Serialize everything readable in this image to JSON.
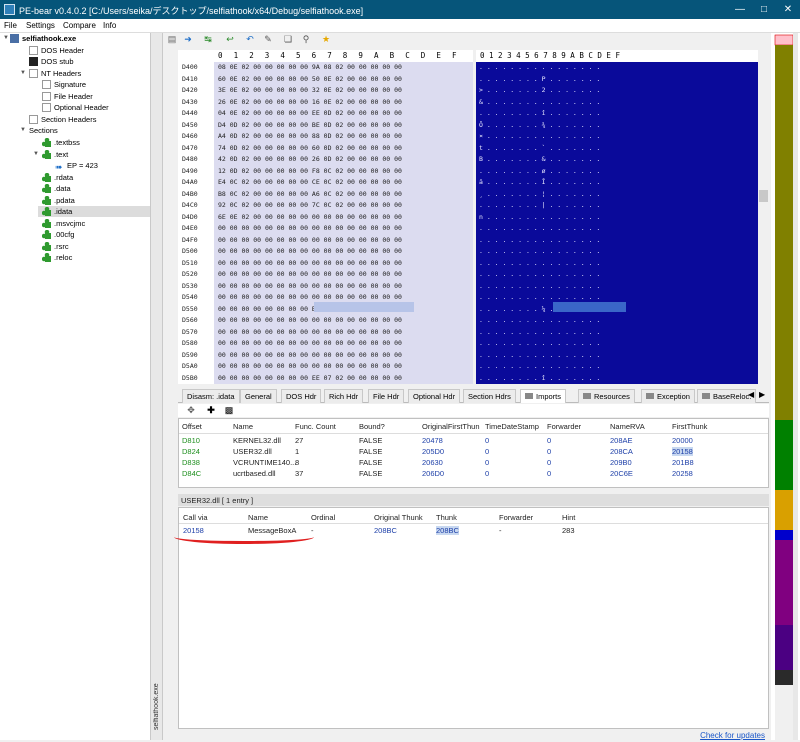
{
  "window": {
    "title": "PE-bear v0.4.0.2 [C:/Users/seika/デスクトップ/selfiathook/x64/Debug/selfiathook.exe]"
  },
  "menu": [
    "File",
    "Settings",
    "Compare",
    "Info"
  ],
  "tree": {
    "root": "selfiathook.exe",
    "dos_header": "DOS Header",
    "dos_stub": "DOS stub",
    "nt_headers": "NT Headers",
    "signature": "Signature",
    "file_header": "File Header",
    "optional_header": "Optional Header",
    "section_headers": "Section Headers",
    "sections": "Sections",
    "sec_textbss": ".textbss",
    "sec_text": ".text",
    "ep": "EP = 423",
    "sec_rdata": ".rdata",
    "sec_data": ".data",
    "sec_pdata": ".pdata",
    "sec_idata": ".idata",
    "sec_msvcjmc": ".msvcjmc",
    "sec_00cfg": ".00cfg",
    "sec_rsrc": ".rsrc",
    "sec_reloc": ".reloc"
  },
  "side_tab": "selfiathook.exe",
  "hex": {
    "header_hex": [
      "0",
      "1",
      "2",
      "3",
      "4",
      "5",
      "6",
      "7",
      "8",
      "9",
      "A",
      "B",
      "C",
      "D",
      "E",
      "F"
    ],
    "header_ascii": "0 1 2 3 4 5 6 7 8 9 A B C D E F",
    "rows": [
      {
        "addr": "D400",
        "hex": "08 0E 02 00 00 00 00 00 9A 08 02 00 00 00 00 00",
        "ascii": ". . . . . . . . . . . . . . . ."
      },
      {
        "addr": "D410",
        "hex": "60 0E 02 00 00 00 00 00 50 0E 02 00 00 00 00 00",
        "ascii": ". . . . . . . . P . . . . . . ."
      },
      {
        "addr": "D420",
        "hex": "3E 0E 02 00 00 00 00 00 32 0E 02 00 00 00 00 00",
        "ascii": "> . . . . . . . 2 . . . . . . ."
      },
      {
        "addr": "D430",
        "hex": "26 0E 02 00 00 00 00 00 16 0E 02 00 00 00 00 00",
        "ascii": "& . . . . . . . . . . . . . . ."
      },
      {
        "addr": "D440",
        "hex": "04 0E 02 00 00 00 00 00 EE 0D 02 00 00 00 00 00",
        "ascii": ". . . . . . . . î . . . . . . ."
      },
      {
        "addr": "D450",
        "hex": "D4 0D 02 00 00 00 00 00 BE 0D 02 00 00 00 00 00",
        "ascii": "Ô . . . . . . . ¾ . . . . . . ."
      },
      {
        "addr": "D460",
        "hex": "A4 0D 02 00 00 00 00 00 88 0D 02 00 00 00 00 00",
        "ascii": "¤ . . . . . . . . . . . . . . ."
      },
      {
        "addr": "D470",
        "hex": "74 0D 02 00 00 00 00 00 60 0D 02 00 00 00 00 00",
        "ascii": "t . . . . . . . ` . . . . . . ."
      },
      {
        "addr": "D480",
        "hex": "42 0D 02 00 00 00 00 00 26 0D 02 00 00 00 00 00",
        "ascii": "B . . . . . . . & . . . . . . ."
      },
      {
        "addr": "D490",
        "hex": "12 0D 02 00 00 00 00 00 F8 0C 02 00 00 00 00 00",
        "ascii": ". . . . . . . . ø . . . . . . ."
      },
      {
        "addr": "D4A0",
        "hex": "E4 0C 02 00 00 00 00 00 CE 0C 02 00 00 00 00 00",
        "ascii": "ä . . . . . . . Î . . . . . . ."
      },
      {
        "addr": "D4B0",
        "hex": "B8 0C 02 00 00 00 00 00 A6 0C 02 00 00 00 00 00",
        "ascii": "¸ . . . . . . . ¦ . . . . . . ."
      },
      {
        "addr": "D4C0",
        "hex": "92 0C 02 00 00 00 00 00 7C 0C 02 00 00 00 00 00",
        "ascii": ". . . . . . . . | . . . . . . ."
      },
      {
        "addr": "D4D0",
        "hex": "6E 0E 02 00 00 00 00 00 00 00 00 00 00 00 00 00",
        "ascii": "n . . . . . . . . . . . . . . ."
      },
      {
        "addr": "D4E0",
        "hex": "00 00 00 00 00 00 00 00 00 00 00 00 00 00 00 00",
        "ascii": ". . . . . . . . . . . . . . . ."
      },
      {
        "addr": "D4F0",
        "hex": "00 00 00 00 00 00 00 00 00 00 00 00 00 00 00 00",
        "ascii": ". . . . . . . . . . . . . . . ."
      },
      {
        "addr": "D500",
        "hex": "00 00 00 00 00 00 00 00 00 00 00 00 00 00 00 00",
        "ascii": ". . . . . . . . . . . . . . . ."
      },
      {
        "addr": "D510",
        "hex": "00 00 00 00 00 00 00 00 00 00 00 00 00 00 00 00",
        "ascii": ". . . . . . . . . . . . . . . ."
      },
      {
        "addr": "D520",
        "hex": "00 00 00 00 00 00 00 00 00 00 00 00 00 00 00 00",
        "ascii": ". . . . . . . . . . . . . . . ."
      },
      {
        "addr": "D530",
        "hex": "00 00 00 00 00 00 00 00 00 00 00 00 00 00 00 00",
        "ascii": ". . . . . . . . . . . . . . . ."
      },
      {
        "addr": "D540",
        "hex": "00 00 00 00 00 00 00 00 00 00 00 00 00 00 00 00",
        "ascii": ". . . . . . . . . . . . . . . ."
      },
      {
        "addr": "D550",
        "hex": "00 00 00 00 00 00 00 00 BC 08 02 00 00 00 00 00",
        "ascii": ". . . . . . . . ¼ . . . . . . ."
      },
      {
        "addr": "D560",
        "hex": "00 00 00 00 00 00 00 00 00 00 00 00 00 00 00 00",
        "ascii": ". . . . . . . . . . . . . . . ."
      },
      {
        "addr": "D570",
        "hex": "00 00 00 00 00 00 00 00 00 00 00 00 00 00 00 00",
        "ascii": ". . . . . . . . . . . . . . . ."
      },
      {
        "addr": "D580",
        "hex": "00 00 00 00 00 00 00 00 00 00 00 00 00 00 00 00",
        "ascii": ". . . . . . . . . . . . . . . ."
      },
      {
        "addr": "D590",
        "hex": "00 00 00 00 00 00 00 00 00 00 00 00 00 00 00 00",
        "ascii": ". . . . . . . . . . . . . . . ."
      },
      {
        "addr": "D5A0",
        "hex": "00 00 00 00 00 00 00 00 00 00 00 00 00 00 00 00",
        "ascii": ". . . . . . . . . . . . . . . ."
      },
      {
        "addr": "D5B0",
        "hex": "00 00 00 00 00 00 00 00 EE 07 02 00 00 00 00 00",
        "ascii": ". . . . . . . . î . . . . . . ."
      }
    ]
  },
  "tabs": [
    "Disasm: .idata",
    "General",
    "DOS Hdr",
    "Rich Hdr",
    "File Hdr",
    "Optional Hdr",
    "Section Hdrs",
    "Imports",
    "Resources",
    "Exception",
    "BaseReloc."
  ],
  "imports": {
    "columns": [
      "Offset",
      "Name",
      "Func. Count",
      "Bound?",
      "OriginalFirstThun",
      "TimeDateStamp",
      "Forwarder",
      "NameRVA",
      "FirstThunk"
    ],
    "rows": [
      [
        "D810",
        "KERNEL32.dll",
        "27",
        "FALSE",
        "20478",
        "0",
        "0",
        "208AE",
        "20000"
      ],
      [
        "D824",
        "USER32.dll",
        "1",
        "FALSE",
        "205D0",
        "0",
        "0",
        "208CA",
        "20158"
      ],
      [
        "D838",
        "VCRUNTIME140...",
        "8",
        "FALSE",
        "20630",
        "0",
        "0",
        "209B0",
        "201B8"
      ],
      [
        "D84C",
        "ucrtbased.dll",
        "37",
        "FALSE",
        "206D0",
        "0",
        "0",
        "20C6E",
        "20258"
      ]
    ]
  },
  "dll_bar": "USER32.dll   [ 1 entry ]",
  "functions": {
    "columns": [
      "Call via",
      "Name",
      "Ordinal",
      "Original Thunk",
      "Thunk",
      "Forwarder",
      "Hint"
    ],
    "rows": [
      [
        "20158",
        "MessageBoxA",
        "-",
        "208BC",
        "208BC",
        "-",
        "283"
      ]
    ]
  },
  "status": {
    "link": "Check for updates"
  },
  "colors": {
    "titlebar": "#06557a",
    "ascii_bg": "#0a0a9a",
    "hex_bg": "#dcdcf0",
    "accent_red": "#e02020"
  }
}
